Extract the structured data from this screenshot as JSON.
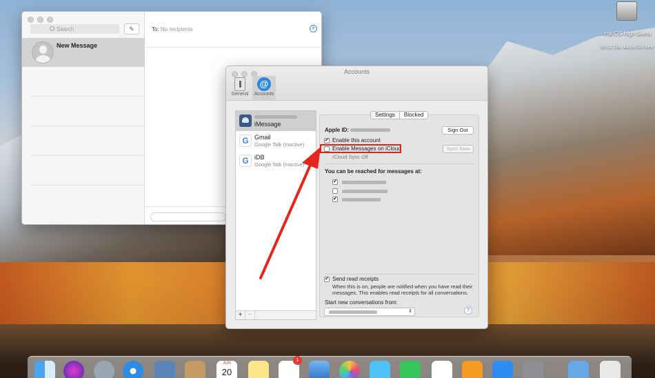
{
  "messages": {
    "search_placeholder": "Search",
    "compose_icon": "compose-icon",
    "new_message": "New Message",
    "to_label": "To:",
    "to_value": "No recipients"
  },
  "accounts": {
    "window_title": "Accounts",
    "toolbar": [
      {
        "label": "General",
        "icon": "general-switch-icon"
      },
      {
        "label": "Accounts",
        "icon": "at-sign-icon"
      }
    ],
    "list": [
      {
        "name": "iMessage",
        "subtitle": ""
      },
      {
        "name": "Gmail",
        "subtitle": "Google Talk (Inactive)"
      },
      {
        "name": "iDB",
        "subtitle": "Google Talk (Inactive)"
      }
    ],
    "list_footer": {
      "add": "+",
      "remove": "−"
    },
    "tabs": {
      "settings": "Settings",
      "blocked": "Blocked"
    },
    "apple_id_label": "Apple ID:",
    "sign_out": "Sign Out",
    "enable_account": "Enable this account",
    "enable_icloud": "Enable Messages on iCloud",
    "sync_now": "Sync Now",
    "icloud_status": "iCloud Sync Off",
    "reach_label": "You can be reached for messages at:",
    "reach_items": [
      true,
      false,
      true
    ],
    "read_receipts": "Send read receipts",
    "read_receipts_desc": "When this is on, people are notified when you have read their messages. This enables read receipts for all conversations.",
    "start_from": "Start new conversations from:",
    "help": "?"
  },
  "desktop": {
    "drive_name": "macOS High Sierra",
    "drive_free": "95,02 GB, 44,06 GB free"
  },
  "dock": {
    "calendar_month": "JUN",
    "calendar_day": "20",
    "mail_badge": "1"
  }
}
